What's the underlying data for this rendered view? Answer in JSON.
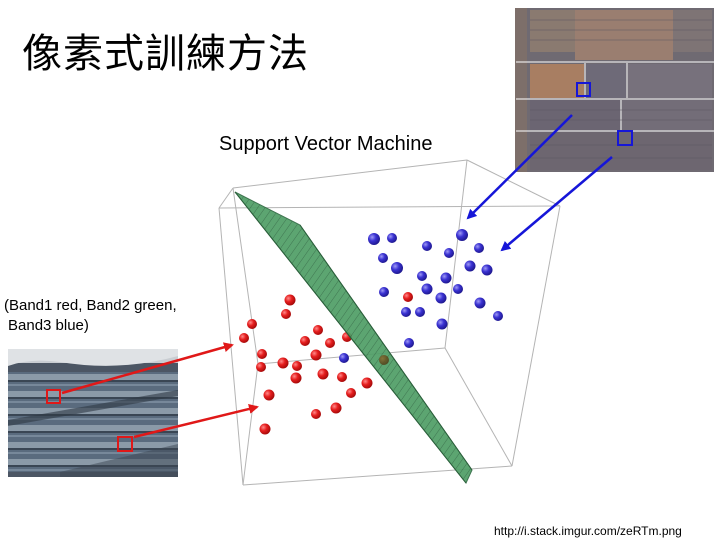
{
  "slide": {
    "title": "像素式訓練方法",
    "diagram_title": "Support Vector Machine",
    "band_note": [
      "(Band1 red, Band2 green,",
      "Band3 blue)"
    ],
    "source": "http://i.stack.imgur.com/zeRTm.png"
  },
  "colors": {
    "class_red": "#e61e1e",
    "class_blue": "#3a32d2",
    "hyperplane": "#3f9a5c",
    "arrow_red": "#e01818",
    "arrow_blue": "#1616d8",
    "cube_edge": "#b4b4b4"
  }
}
